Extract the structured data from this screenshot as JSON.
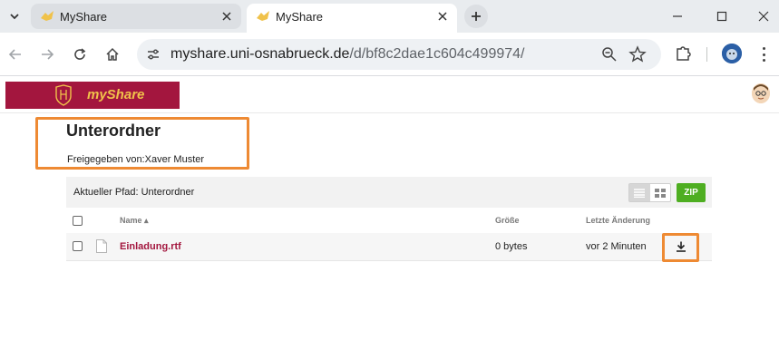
{
  "browser": {
    "tabs": [
      {
        "title": "MyShare",
        "active": false
      },
      {
        "title": "MyShare",
        "active": true
      }
    ],
    "address": {
      "host": "myshare.uni-osnabrueck.de",
      "path": "/d/bf8c2dae1c604c499974/"
    }
  },
  "app": {
    "logo_text": "myShare",
    "brand_color": "#a3163e",
    "accent_color": "#f0c24a"
  },
  "folder": {
    "title": "Unterordner",
    "shared_by": "Freigegeben von:Xaver Muster",
    "current_path": "Aktueller Pfad: Unterordner",
    "zip_label": "ZIP"
  },
  "table": {
    "headers": {
      "name": "Name ▴",
      "size": "Größe",
      "modified": "Letzte Änderung"
    },
    "rows": [
      {
        "name": "Einladung.rtf",
        "size": "0 bytes",
        "modified": "vor 2 Minuten"
      }
    ]
  },
  "highlight_color": "#ee8a33"
}
